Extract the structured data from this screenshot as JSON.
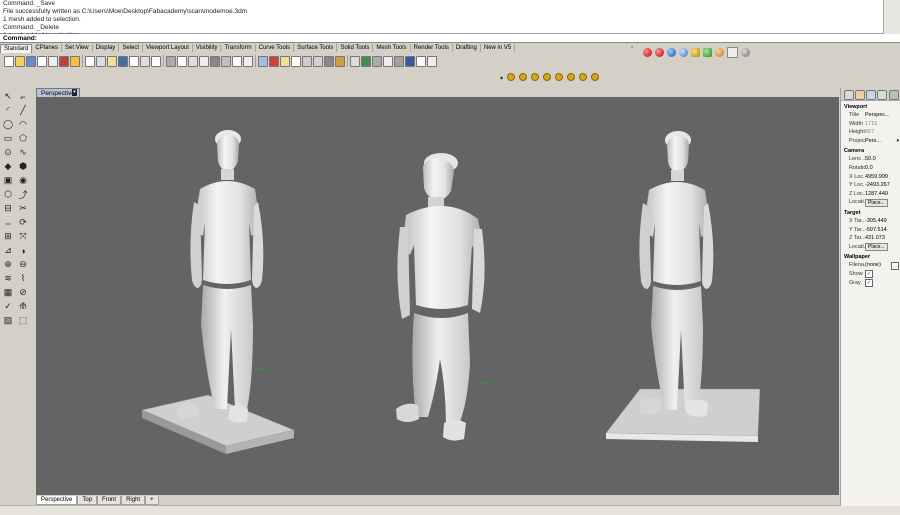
{
  "command_history": [
    "Command: _Save",
    "File successfully written as C:\\Users\\Moe\\Desktop\\Fabacademy\\scan\\modemoe.3dm",
    "1 mesh added to selection.",
    "Command: _Delete",
    "1 mesh added to selection."
  ],
  "command_prompt": "Command:",
  "toolbar_tabs": [
    "Standard",
    "CPlanes",
    "Set View",
    "Display",
    "Select",
    "Viewport Layout",
    "Visibility",
    "Transform",
    "Curve Tools",
    "Surface Tools",
    "Solid Tools",
    "Mesh Tools",
    "Render Tools",
    "Drafting",
    "New in V5"
  ],
  "active_tab": "Standard",
  "viewport": {
    "title": "Perspective",
    "background": "#646464",
    "model_color": "#ececec"
  },
  "bottom_tabs": [
    "Perspective",
    "Top",
    "Front",
    "Right"
  ],
  "add_tab_icon": "add-viewport-icon",
  "properties": {
    "viewport_section": "Viewport",
    "title_label": "Title",
    "title_value": "Perspec...",
    "width_label": "Width",
    "width_value": "1715",
    "height_label": "Height",
    "height_value": "867",
    "projection_label": "Projec...",
    "projection_value": "Pers...",
    "camera_section": "Camera",
    "lens_label": "Lens ...",
    "lens_value": "50.0",
    "rotation_label": "Rotation",
    "rotation_value": "0.0",
    "xloc_label": "X Loc...",
    "xloc_value": "4959.999",
    "yloc_label": "Y Loc...",
    "yloc_value": "-2493.267",
    "zloc_label": "Z Loc...",
    "zloc_value": "1287.449",
    "cam_locate_label": "Locati...",
    "place_button": "Place...",
    "target_section": "Target",
    "xtar_label": "X Tar...",
    "xtar_value": "-305.449",
    "ytar_label": "Y Tar...",
    "ytar_value": "-597.514",
    "ztar_label": "Z Tar...",
    "ztar_value": "431.073",
    "tar_locate_label": "Locati...",
    "wallpaper_section": "Wallpaper",
    "filename_label": "Filena...",
    "filename_value": "(none)",
    "show_label": "Show",
    "gray_label": "Gray",
    "check_mark": "✓",
    "browse_glyph": "…"
  },
  "accent_colors": {
    "chrome": "#d4d0c8",
    "active_viewport_tab": "#b8c4d6"
  }
}
